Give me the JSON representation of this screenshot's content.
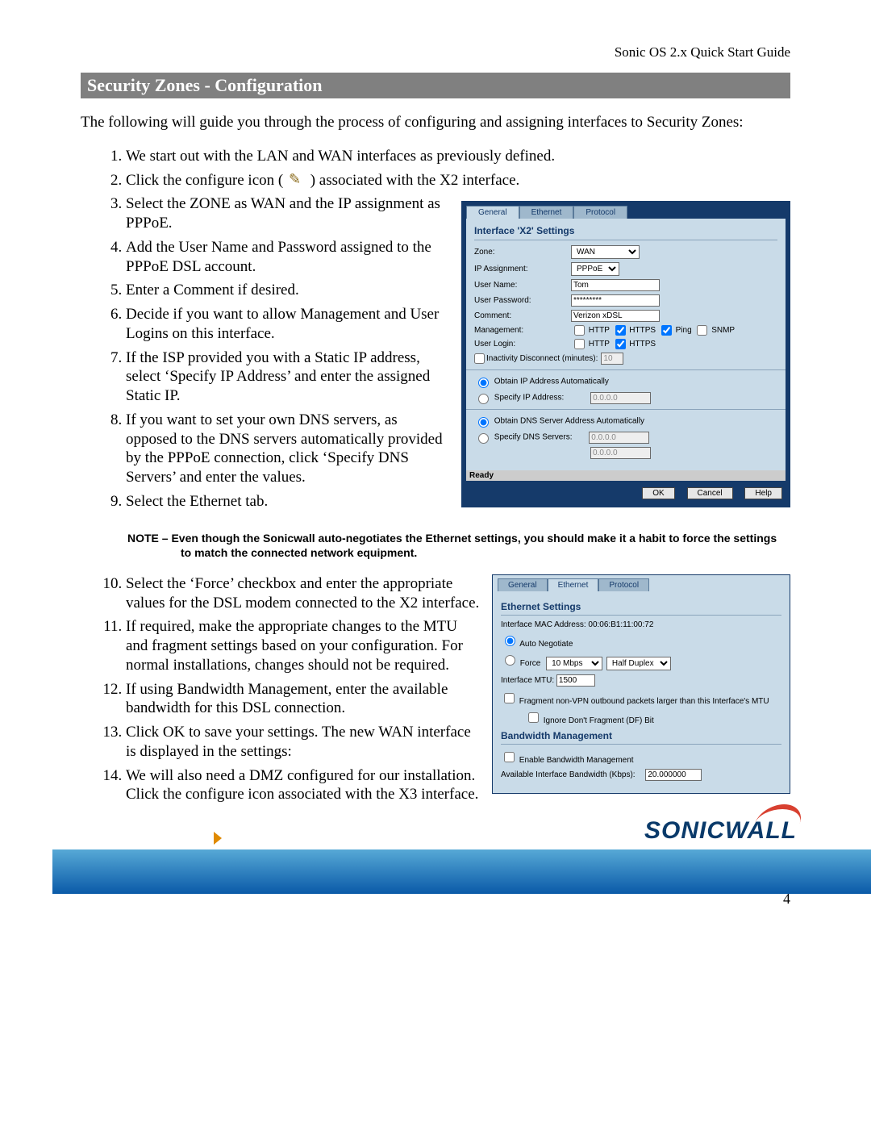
{
  "doc": {
    "header": "Sonic OS 2.x Quick Start Guide",
    "page_number": "4",
    "logo_text": "SONICWALL"
  },
  "section": {
    "title": "Security Zones - Configuration",
    "intro": "The following will guide you through the process of configuring and assigning interfaces to Security Zones:"
  },
  "steps_a": [
    "We start out with the LAN and WAN interfaces as previously defined.",
    "Click the configure icon ( [icon] ) associated with the X2 interface.",
    "Select the ZONE as WAN and the IP assignment as PPPoE.",
    "Add the User Name and Password assigned to the PPPoE DSL account.",
    "Enter a Comment if desired.",
    "Decide if you want to allow Management and User Logins on this interface.",
    "If the ISP provided you with a Static IP address, select ‘Specify IP Address’ and enter the assigned Static IP.",
    "If you want to set your own DNS servers, as opposed to the DNS servers automatically provided by the PPPoE connection, click ‘Specify DNS Servers’ and enter the values.",
    "Select the Ethernet tab."
  ],
  "note": {
    "prefix": "NOTE – ",
    "text": "Even though the Sonicwall auto-negotiates the Ethernet settings, you should make it a habit to force the settings to match the connected network equipment."
  },
  "steps_b": [
    "Select the ‘Force’ checkbox and enter the appropriate values for the DSL modem connected to the X2 interface.",
    "If required, make the appropriate changes to the MTU and fragment settings based on your configuration. For normal installations, changes should not be required.",
    "If using Bandwidth Management, enter the available bandwidth for this DSL connection.",
    "Click OK to save your settings. The new WAN interface is displayed in the settings:",
    "We will also need a DMZ configured for our installation. Click the configure icon associated with the X3 interface."
  ],
  "fig1": {
    "tabs": [
      "General",
      "Ethernet",
      "Protocol"
    ],
    "active_tab": 0,
    "title": "Interface 'X2' Settings",
    "labels": {
      "zone": "Zone:",
      "ip_assignment": "IP Assignment:",
      "user_name": "User Name:",
      "user_password": "User Password:",
      "comment": "Comment:",
      "management": "Management:",
      "user_login": "User Login:",
      "inactivity": "Inactivity Disconnect (minutes):",
      "obtain_ip": "Obtain IP Address Automatically",
      "specify_ip": "Specify IP Address:",
      "obtain_dns": "Obtain DNS Server Address Automatically",
      "specify_dns": "Specify DNS Servers:"
    },
    "values": {
      "zone": "WAN",
      "ip_assignment": "PPPoE",
      "user_name": "Tom",
      "user_password": "*********",
      "comment": "Verizon xDSL",
      "inactivity_minutes": "10",
      "ip_addr": "0.0.0.0",
      "dns1": "0.0.0.0",
      "dns2": "0.0.0.0"
    },
    "mgmt_options": [
      "HTTP",
      "HTTPS",
      "Ping",
      "SNMP"
    ],
    "mgmt_checked": [
      false,
      true,
      true,
      false
    ],
    "login_options": [
      "HTTP",
      "HTTPS"
    ],
    "login_checked": [
      false,
      true
    ],
    "status": "Ready",
    "buttons": {
      "ok": "OK",
      "cancel": "Cancel",
      "help": "Help"
    }
  },
  "fig2": {
    "tabs": [
      "General",
      "Ethernet",
      "Protocol"
    ],
    "active_tab": 1,
    "title": "Ethernet Settings",
    "labels": {
      "mac_label": "Interface MAC Address:",
      "auto_negotiate": "Auto Negotiate",
      "force": "Force",
      "mtu": "Interface MTU:",
      "fragment": "Fragment non-VPN outbound packets larger than this Interface's MTU",
      "ignore_df": "Ignore Don't Fragment (DF) Bit",
      "bw_title": "Bandwidth Management",
      "enable_bw": "Enable Bandwidth Management",
      "avail_bw": "Available Interface Bandwidth (Kbps):"
    },
    "values": {
      "mac": "00:06:B1:11:00:72",
      "speed": "10 Mbps",
      "duplex": "Half Duplex",
      "mtu": "1500",
      "bandwidth": "20.000000"
    }
  }
}
